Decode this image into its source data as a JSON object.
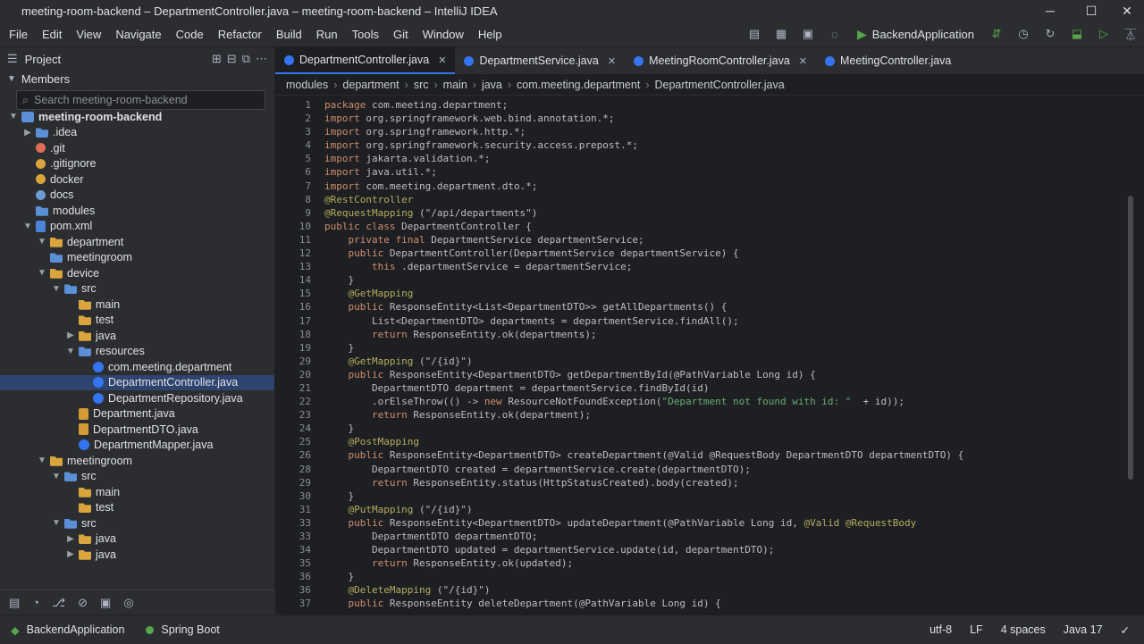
{
  "window": {
    "title": "meeting-room-backend – DepartmentController.java – meeting-room-backend – IntelliJ IDEA",
    "controls": {
      "minimize": "─",
      "maximize": "☐",
      "close": "✕"
    }
  },
  "menu": [
    "File",
    "Edit",
    "View",
    "Navigate",
    "Code",
    "Refactor",
    "Build",
    "Run",
    "Tools",
    "Git",
    "Window",
    "Help"
  ],
  "toolbar": {
    "run_config": "BackendApplication"
  },
  "project_panel": {
    "title": "Project",
    "members_label": "Members",
    "search_placeholder": "Search meeting-room-backend",
    "tree": [
      {
        "label": "meeting-room-backend",
        "depth": 0,
        "arrow": "open",
        "icon": "modfolder",
        "bold": true
      },
      {
        "label": ".idea",
        "depth": 1,
        "arrow": "closed",
        "icon": "folder-blue"
      },
      {
        "label": ".git",
        "depth": 1,
        "arrow": "",
        "icon": "gitfile"
      },
      {
        "label": ".gitignore",
        "depth": 1,
        "arrow": "",
        "icon": "ignfile"
      },
      {
        "label": "docker",
        "depth": 1,
        "arrow": "",
        "icon": "dockfile"
      },
      {
        "label": "docs",
        "depth": 1,
        "arrow": "",
        "icon": "docsfile"
      },
      {
        "label": "modules",
        "depth": 1,
        "arrow": "",
        "icon": "folder-blue"
      },
      {
        "label": "pom.xml",
        "depth": 1,
        "arrow": "open",
        "icon": "pomfile"
      },
      {
        "label": "department",
        "depth": 2,
        "arrow": "open",
        "icon": "folder"
      },
      {
        "label": "meetingroom",
        "depth": 2,
        "arrow": "",
        "icon": "folder-blue"
      },
      {
        "label": "device",
        "depth": 2,
        "arrow": "open",
        "icon": "folder"
      },
      {
        "label": "src",
        "depth": 3,
        "arrow": "open",
        "icon": "folder-blue"
      },
      {
        "label": "main",
        "depth": 4,
        "arrow": "",
        "icon": "folder"
      },
      {
        "label": "test",
        "depth": 4,
        "arrow": "",
        "icon": "folder"
      },
      {
        "label": "java",
        "depth": 4,
        "arrow": "closed",
        "icon": "folder"
      },
      {
        "label": "resources",
        "depth": 4,
        "arrow": "open",
        "icon": "folder-blue"
      },
      {
        "label": "com.meeting.department",
        "depth": 5,
        "arrow": "",
        "icon": "jfile"
      },
      {
        "label": "DepartmentController.java",
        "depth": 5,
        "arrow": "",
        "icon": "jfile",
        "selected": true
      },
      {
        "label": "DepartmentRepository.java",
        "depth": 5,
        "arrow": "",
        "icon": "jfile"
      },
      {
        "label": "Department.java",
        "depth": 4,
        "arrow": "",
        "icon": "jfile-o"
      },
      {
        "label": "DepartmentDTO.java",
        "depth": 4,
        "arrow": "",
        "icon": "jfile-o"
      },
      {
        "label": "DepartmentMapper.java",
        "depth": 4,
        "arrow": "",
        "icon": "jfile"
      },
      {
        "label": "meetingroom",
        "depth": 2,
        "arrow": "open",
        "icon": "folder"
      },
      {
        "label": "src",
        "depth": 3,
        "arrow": "open",
        "icon": "folder-blue"
      },
      {
        "label": "main",
        "depth": 4,
        "arrow": "",
        "icon": "folder"
      },
      {
        "label": "test",
        "depth": 4,
        "arrow": "",
        "icon": "folder"
      },
      {
        "label": "src",
        "depth": 3,
        "arrow": "open",
        "icon": "folder-blue"
      },
      {
        "label": "java",
        "depth": 4,
        "arrow": "closed",
        "icon": "folder"
      },
      {
        "label": "java",
        "depth": 4,
        "arrow": "closed",
        "icon": "folder"
      }
    ]
  },
  "tabs": [
    {
      "label": "DepartmentController.java",
      "active": true,
      "closable": true
    },
    {
      "label": "DepartmentService.java",
      "active": false,
      "closable": true
    },
    {
      "label": "MeetingRoomController.java",
      "active": false,
      "closable": true
    },
    {
      "label": "MeetingController.java",
      "active": false,
      "closable": false
    }
  ],
  "breadcrumb": [
    "modules",
    "department",
    "src",
    "main",
    "java",
    "com.meeting.department",
    "DepartmentController.java"
  ],
  "editor": {
    "lines": [
      {
        "n": "1",
        "segs": [
          [
            "kw",
            "package"
          ],
          [
            "",
            "com.meeting.department;"
          ]
        ]
      },
      {
        "n": "2",
        "segs": [
          [
            "kw",
            "import"
          ],
          [
            "",
            "org.springframework.web.bind.annotation.*;"
          ]
        ]
      },
      {
        "n": "3",
        "segs": [
          [
            "kw",
            "import"
          ],
          [
            "",
            "org.springframework.http.*;"
          ]
        ]
      },
      {
        "n": "4",
        "segs": [
          [
            "kw",
            "import"
          ],
          [
            "",
            "org.springframework.security.access.prepost.*;"
          ]
        ]
      },
      {
        "n": "5",
        "segs": [
          [
            "kw",
            "import"
          ],
          [
            "",
            "jakarta.validation.*;"
          ]
        ]
      },
      {
        "n": "6",
        "segs": [
          [
            "kw",
            "import"
          ],
          [
            "",
            "java.util.*;"
          ]
        ]
      },
      {
        "n": "7",
        "segs": [
          [
            "kw",
            "import"
          ],
          [
            "",
            "com.meeting.department.dto.*;"
          ]
        ]
      },
      {
        "n": "8",
        "segs": [
          [
            "an",
            "@RestController"
          ]
        ]
      },
      {
        "n": "9",
        "segs": [
          [
            "an",
            "@RequestMapping"
          ],
          [
            "",
            "(\"/api/departments\")"
          ]
        ]
      },
      {
        "n": "10",
        "segs": [
          [
            "kw",
            "public class"
          ],
          [
            "",
            "DepartmentController {"
          ]
        ]
      },
      {
        "n": "11",
        "segs": [
          [
            "",
            "    "
          ],
          [
            "kw",
            "private final"
          ],
          [
            "",
            "DepartmentService departmentService;"
          ]
        ]
      },
      {
        "n": "12",
        "segs": [
          [
            "",
            "    "
          ],
          [
            "kw",
            "public"
          ],
          [
            "",
            "DepartmentController(DepartmentService departmentService) {"
          ]
        ]
      },
      {
        "n": "13",
        "segs": [
          [
            "",
            "        "
          ],
          [
            "kw",
            "this"
          ],
          [
            "",
            ".departmentService = departmentService;"
          ]
        ]
      },
      {
        "n": "14",
        "segs": [
          [
            "",
            "    }"
          ]
        ]
      },
      {
        "n": "15",
        "segs": [
          [
            "",
            "    "
          ],
          [
            "an",
            "@GetMapping"
          ]
        ]
      },
      {
        "n": "16",
        "segs": [
          [
            "",
            "    "
          ],
          [
            "kw",
            "public"
          ],
          [
            "",
            "ResponseEntity<List<DepartmentDTO>> getAllDepartments() {"
          ]
        ]
      },
      {
        "n": "17",
        "segs": [
          [
            "",
            "        List<DepartmentDTO> departments = departmentService.findAll();"
          ]
        ]
      },
      {
        "n": "18",
        "segs": [
          [
            "",
            "        "
          ],
          [
            "kw",
            "return"
          ],
          [
            "",
            "ResponseEntity.ok(departments);"
          ]
        ]
      },
      {
        "n": "19",
        "segs": [
          [
            "",
            "    }"
          ]
        ]
      },
      {
        "n": "29",
        "segs": [
          [
            "",
            "    "
          ],
          [
            "an",
            "@GetMapping"
          ],
          [
            "",
            "(\"/{id}\")"
          ]
        ]
      },
      {
        "n": "20",
        "segs": [
          [
            "",
            "    "
          ],
          [
            "kw",
            "public"
          ],
          [
            "",
            "ResponseEntity<DepartmentDTO> getDepartmentById(@PathVariable Long id) {"
          ]
        ]
      },
      {
        "n": "21",
        "segs": [
          [
            "",
            "        DepartmentDTO department = departmentService.findById(id)"
          ]
        ]
      },
      {
        "n": "22",
        "segs": [
          [
            "",
            "        .orElseThrow(() -> "
          ],
          [
            "kw",
            "new"
          ],
          [
            "",
            "ResourceNotFoundException("
          ],
          [
            "str",
            "\"Department not found with id: \""
          ],
          [
            "",
            " + id));"
          ]
        ]
      },
      {
        "n": "23",
        "segs": [
          [
            "",
            "        "
          ],
          [
            "kw",
            "return"
          ],
          [
            "",
            "ResponseEntity.ok(department);"
          ]
        ]
      },
      {
        "n": "24",
        "segs": [
          [
            "",
            "    }"
          ]
        ]
      },
      {
        "n": "25",
        "segs": [
          [
            "",
            "    "
          ],
          [
            "an",
            "@PostMapping"
          ]
        ]
      },
      {
        "n": "26",
        "segs": [
          [
            "",
            "    "
          ],
          [
            "kw",
            "public"
          ],
          [
            "",
            "ResponseEntity<DepartmentDTO> createDepartment(@Valid @RequestBody DepartmentDTO departmentDTO) {"
          ]
        ]
      },
      {
        "n": "28",
        "segs": [
          [
            "",
            "        DepartmentDTO created = departmentService.create(departmentDTO);"
          ]
        ]
      },
      {
        "n": "29",
        "segs": [
          [
            "",
            "        "
          ],
          [
            "kw",
            "return"
          ],
          [
            "",
            "ResponseEntity.status(HttpStatusCreated).body(created);"
          ]
        ]
      },
      {
        "n": "30",
        "segs": [
          [
            "",
            "    }"
          ]
        ]
      },
      {
        "n": "31",
        "segs": [
          [
            "",
            "    "
          ],
          [
            "an",
            "@PutMapping"
          ],
          [
            "",
            "(\"/{id}\")"
          ]
        ]
      },
      {
        "n": "33",
        "segs": [
          [
            "",
            "    "
          ],
          [
            "kw",
            "public"
          ],
          [
            "",
            "ResponseEntity<DepartmentDTO> updateDepartment(@PathVariable Long id, "
          ],
          [
            "an",
            "@Valid @RequestBody"
          ]
        ]
      },
      {
        "n": "33",
        "segs": [
          [
            "",
            "        DepartmentDTO departmentDTO;"
          ]
        ]
      },
      {
        "n": "34",
        "segs": [
          [
            "",
            "        DepartmentDTO updated = departmentService.update(id, departmentDTO);"
          ]
        ]
      },
      {
        "n": "35",
        "segs": [
          [
            "",
            "        "
          ],
          [
            "kw",
            "return"
          ],
          [
            "",
            "ResponseEntity.ok(updated);"
          ]
        ]
      },
      {
        "n": "36",
        "segs": [
          [
            "",
            "    }"
          ]
        ]
      },
      {
        "n": "36",
        "segs": [
          [
            "",
            "    "
          ],
          [
            "an",
            "@DeleteMapping"
          ],
          [
            "",
            "(\"/{id}\")"
          ]
        ]
      },
      {
        "n": "37",
        "segs": [
          [
            "",
            "    "
          ],
          [
            "kw",
            "public"
          ],
          [
            "",
            "ResponseEntity deleteDepartment(@PathVariable Long id) {"
          ]
        ]
      }
    ]
  },
  "statusbar": {
    "run_app": "BackendApplication",
    "framework": "Spring Boot",
    "encoding": "utf-8",
    "line_sep": "LF",
    "indent": "4 spaces",
    "lang": "Java 17"
  }
}
